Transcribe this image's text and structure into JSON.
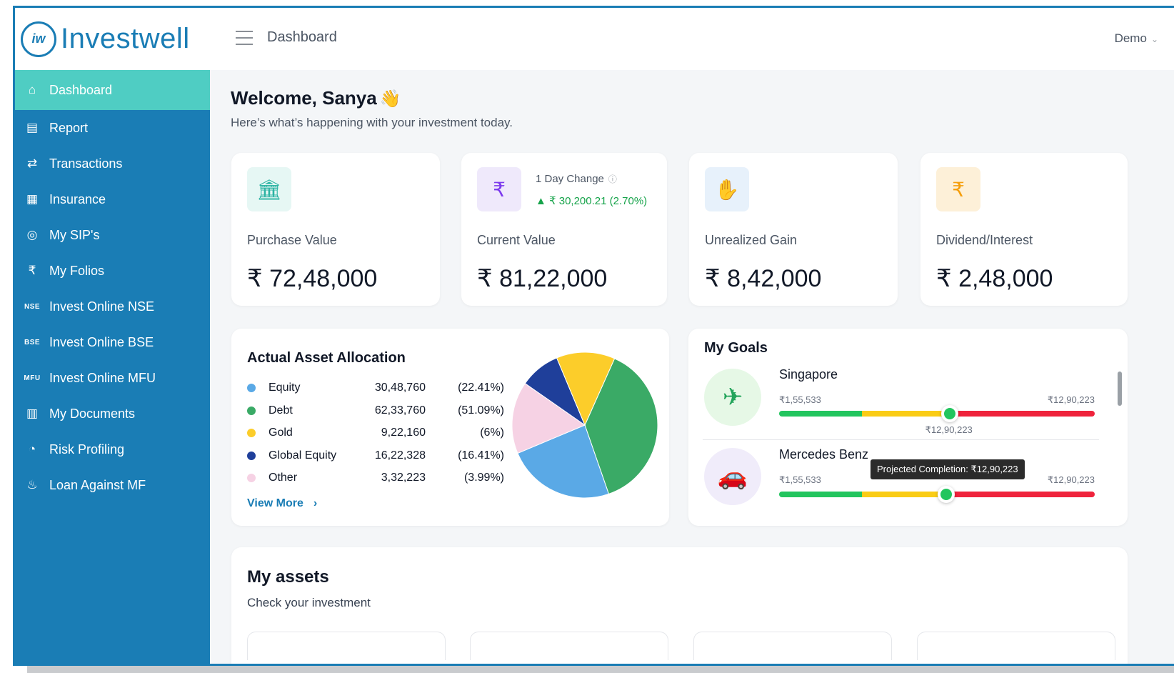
{
  "brand": {
    "logo_mark": "iw",
    "name": "Investwell",
    "color": "#1a7db5",
    "accent": "#4fcdc3"
  },
  "header": {
    "title": "Dashboard",
    "user": "Demo"
  },
  "sidebar": {
    "items": [
      {
        "label": "Dashboard",
        "icon": "home-icon",
        "glyph": "⌂",
        "active": true
      },
      {
        "label": "Report",
        "icon": "report-icon",
        "glyph": "▤"
      },
      {
        "label": "Transactions",
        "icon": "transfer-arrows-icon",
        "glyph": "⇄"
      },
      {
        "label": "Insurance",
        "icon": "insurance-doc-icon",
        "glyph": "▦"
      },
      {
        "label": "My SIP's",
        "icon": "sip-target-icon",
        "glyph": "◎"
      },
      {
        "label": "My Folios",
        "icon": "folio-rupee-icon",
        "glyph": "₹"
      },
      {
        "label": "Invest Online NSE",
        "icon": "nse-icon",
        "glyph": "NSE"
      },
      {
        "label": "Invest Online BSE",
        "icon": "bse-icon",
        "glyph": "BSE"
      },
      {
        "label": "Invest Online MFU",
        "icon": "mfu-icon",
        "glyph": "MFU"
      },
      {
        "label": "My Documents",
        "icon": "document-icon",
        "glyph": "▥"
      },
      {
        "label": "Risk Profiling",
        "icon": "gauge-icon",
        "glyph": "◔"
      },
      {
        "label": "Loan Against MF",
        "icon": "loan-hand-icon",
        "glyph": "♨"
      }
    ]
  },
  "welcome": {
    "title": "Welcome, Sanya",
    "wave": "👋",
    "subtitle": "Here’s what’s happening with your investment today."
  },
  "stats": [
    {
      "label": "Purchase Value",
      "value": "₹ 72,48,000",
      "icon": "bank-building-icon",
      "icon_glyph": "🏛",
      "icon_bg": "#e6f7f4",
      "icon_color": "#2bb3a3"
    },
    {
      "label": "Current Value",
      "value": "₹ 81,22,000",
      "icon": "rupee-coins-icon",
      "icon_glyph": "₹",
      "icon_bg": "#efe9fb",
      "icon_color": "#7c3aed",
      "day_change_label": "1 Day Change",
      "day_change_info": "ⓘ",
      "day_change_value": "▲ ₹ 30,200.21 (2.70%)"
    },
    {
      "label": "Unrealized Gain",
      "value": "₹ 8,42,000",
      "icon": "hand-money-icon",
      "icon_glyph": "✋",
      "icon_bg": "#e7f1fb",
      "icon_color": "#3b82f6"
    },
    {
      "label": "Dividend/Interest",
      "value": "₹ 2,48,000",
      "icon": "money-bag-icon",
      "icon_glyph": "₹",
      "icon_bg": "#fdf0d8",
      "icon_color": "#f59e0b"
    }
  ],
  "allocation": {
    "title": "Actual Asset Allocation",
    "view_more": "View More",
    "rows": [
      {
        "name": "Equity",
        "amount": "30,48,760",
        "pct": "(22.41%)",
        "color": "#5aa9e6"
      },
      {
        "name": "Debt",
        "amount": "62,33,760",
        "pct": "(51.09%)",
        "color": "#3aaa66"
      },
      {
        "name": "Gold",
        "amount": "9,22,160",
        "pct": "(6%)",
        "color": "#fccd2a"
      },
      {
        "name": "Global Equity",
        "amount": "16,22,328",
        "pct": "(16.41%)",
        "color": "#1f3f9a"
      },
      {
        "name": "Other",
        "amount": "3,32,223",
        "pct": "(3.99%)",
        "color": "#f6d2e4"
      }
    ]
  },
  "pie_slices": [
    {
      "name": "Debt",
      "share": 0.38,
      "color": "#3aaa66"
    },
    {
      "name": "Equity",
      "share": 0.24,
      "color": "#5aa9e6"
    },
    {
      "name": "Other",
      "share": 0.16,
      "color": "#f6d2e4"
    },
    {
      "name": "Global Equity",
      "share": 0.09,
      "color": "#1f3f9a"
    },
    {
      "name": "Gold",
      "share": 0.13,
      "color": "#fccd2a"
    }
  ],
  "goals": {
    "title": "My Goals",
    "items": [
      {
        "name": "Singapore",
        "icon": "airplane-icon",
        "glyph": "✈",
        "bg": "#e6f8e6",
        "color": "#22a45a",
        "min": "₹1,55,533",
        "max": "₹12,90,223",
        "projected": "₹12,90,223",
        "progress": 0.54
      },
      {
        "name": "Mercedes Benz",
        "icon": "car-icon",
        "glyph": "🚗",
        "bg": "#f0ecfa",
        "color": "#8b5cf6",
        "min": "₹1,55,533",
        "max": "₹12,90,223",
        "tooltip": "Projected Completion: ₹12,90,223",
        "progress": 0.53
      }
    ]
  },
  "assets": {
    "title": "My assets",
    "subtitle": "Check your investment"
  }
}
